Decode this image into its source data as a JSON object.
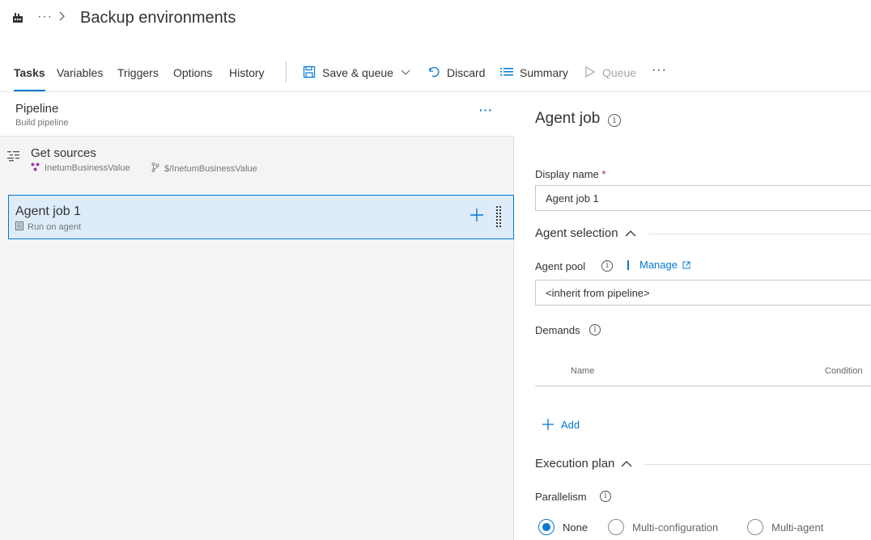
{
  "header": {
    "more": "···",
    "title": "Backup environments",
    "icons": {
      "build": "build-pipeline-icon",
      "chevron": "chevron-right-icon"
    }
  },
  "toolbar": {
    "tabs": [
      {
        "label": "Tasks",
        "active": true
      },
      {
        "label": "Variables",
        "active": false
      },
      {
        "label": "Triggers",
        "active": false
      },
      {
        "label": "Options",
        "active": false
      },
      {
        "label": "History",
        "active": false
      }
    ],
    "save_queue": "Save & queue",
    "discard": "Discard",
    "summary": "Summary",
    "queue": "Queue",
    "more": "···"
  },
  "pipeline": {
    "title": "Pipeline",
    "subtitle": "Build pipeline",
    "more": "···",
    "get_sources": {
      "title": "Get sources",
      "repo": "InetumBusinessValue",
      "branch": "$/InetumBusinessValue"
    },
    "agent_job": {
      "title": "Agent job 1",
      "subtitle": "Run on agent"
    }
  },
  "details": {
    "title": "Agent job",
    "display_name_label": "Display name",
    "required_mark": "*",
    "display_name_value": "Agent job 1",
    "agent_selection": "Agent selection",
    "agent_pool_label": "Agent pool",
    "manage": "Manage",
    "agent_pool_value": "<inherit from pipeline>",
    "demands_label": "Demands",
    "demands_columns": {
      "name": "Name",
      "condition": "Condition"
    },
    "add": "Add",
    "execution_plan": "Execution plan",
    "parallelism_label": "Parallelism",
    "parallelism_options": [
      {
        "label": "None",
        "selected": true
      },
      {
        "label": "Multi-configuration",
        "selected": false
      },
      {
        "label": "Multi-agent",
        "selected": false
      }
    ],
    "info_glyph": "i"
  },
  "colors": {
    "accent": "#0078d4",
    "selected_bg": "#deecf9",
    "pane_bg": "#f4f4f4",
    "text": "#333333",
    "muted": "#767676"
  }
}
